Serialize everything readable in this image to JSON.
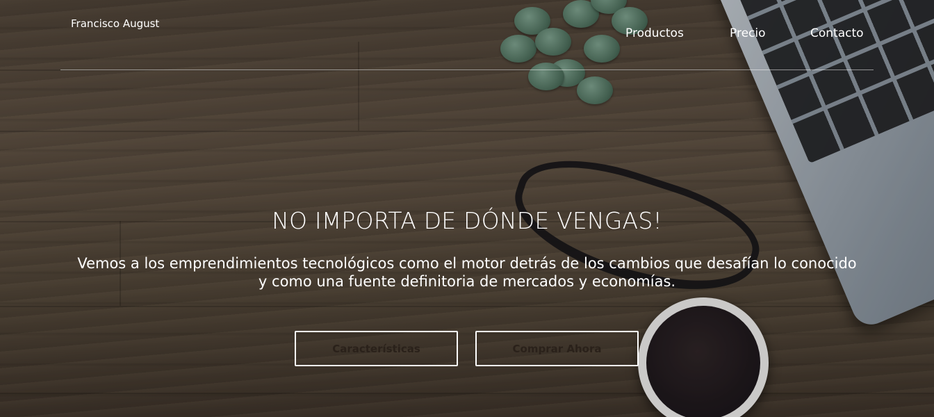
{
  "header": {
    "brand": "Francisco August",
    "nav": [
      "Productos",
      "Precio",
      "Contacto"
    ]
  },
  "hero": {
    "headline": "NO IMPORTA DE DÓNDE VENGAS!",
    "subline": "Vemos a los emprendimientos tecnológicos como el motor detrás de los cambios que desafían lo conocido y como una fuente definitoria de mercados y economías.",
    "buttons": [
      "Características",
      "Comprar Ahora"
    ]
  },
  "colors": {
    "text": "#ffffff",
    "button_text": "#2a211a",
    "wood": "#4d4237"
  },
  "background_icons": [
    "plant-icon",
    "laptop-icon",
    "glasses-icon",
    "coffee-cup-icon"
  ]
}
